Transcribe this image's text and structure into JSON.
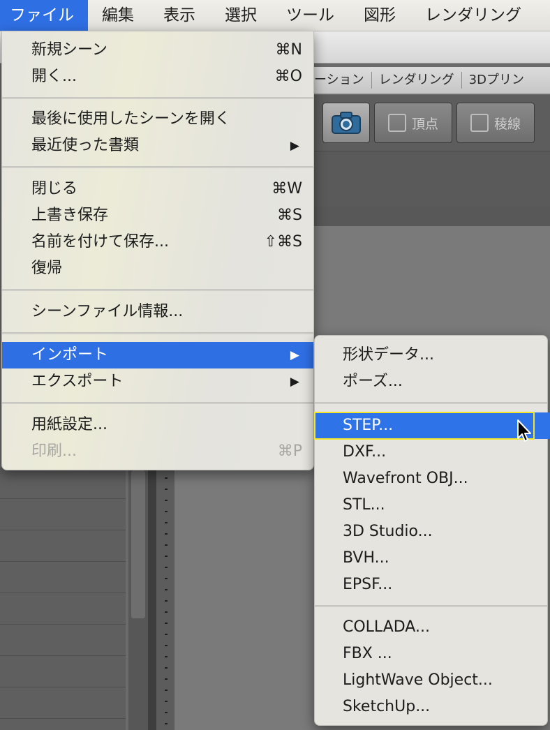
{
  "menubar": {
    "items": [
      "ファイル",
      "編集",
      "表示",
      "選択",
      "ツール",
      "図形",
      "レンダリング"
    ]
  },
  "app": {
    "tabs": [
      "ーション",
      "レンダリング",
      "3Dプリン"
    ],
    "mode_buttons": [
      "頂点",
      "稜線"
    ]
  },
  "file_menu": {
    "items": [
      {
        "label": "新規シーン",
        "shortcut": "⌘N"
      },
      {
        "label": "開く...",
        "shortcut": "⌘O"
      },
      {
        "label": "最後に使用したシーンを開く",
        "shortcut": ""
      },
      {
        "label": "最近使った書類",
        "shortcut": "▶"
      },
      {
        "label": "閉じる",
        "shortcut": "⌘W"
      },
      {
        "label": "上書き保存",
        "shortcut": "⌘S"
      },
      {
        "label": "名前を付けて保存...",
        "shortcut": "⇧⌘S"
      },
      {
        "label": "復帰",
        "shortcut": ""
      },
      {
        "label": "シーンファイル情報...",
        "shortcut": ""
      },
      {
        "label": "インポート",
        "shortcut": "▶"
      },
      {
        "label": "エクスポート",
        "shortcut": "▶"
      },
      {
        "label": "用紙設定...",
        "shortcut": ""
      },
      {
        "label": "印刷...",
        "shortcut": "⌘P"
      }
    ]
  },
  "import_menu": {
    "items": [
      "形状データ...",
      "ポーズ...",
      "STEP...",
      "DXF...",
      "Wavefront OBJ...",
      "STL...",
      "3D Studio...",
      "BVH...",
      "EPSF...",
      "COLLADA...",
      "FBX ...",
      "LightWave Object...",
      "SketchUp..."
    ]
  },
  "colors": {
    "accent": "#2f6fe4",
    "focus_ring": "#f4e72a"
  }
}
